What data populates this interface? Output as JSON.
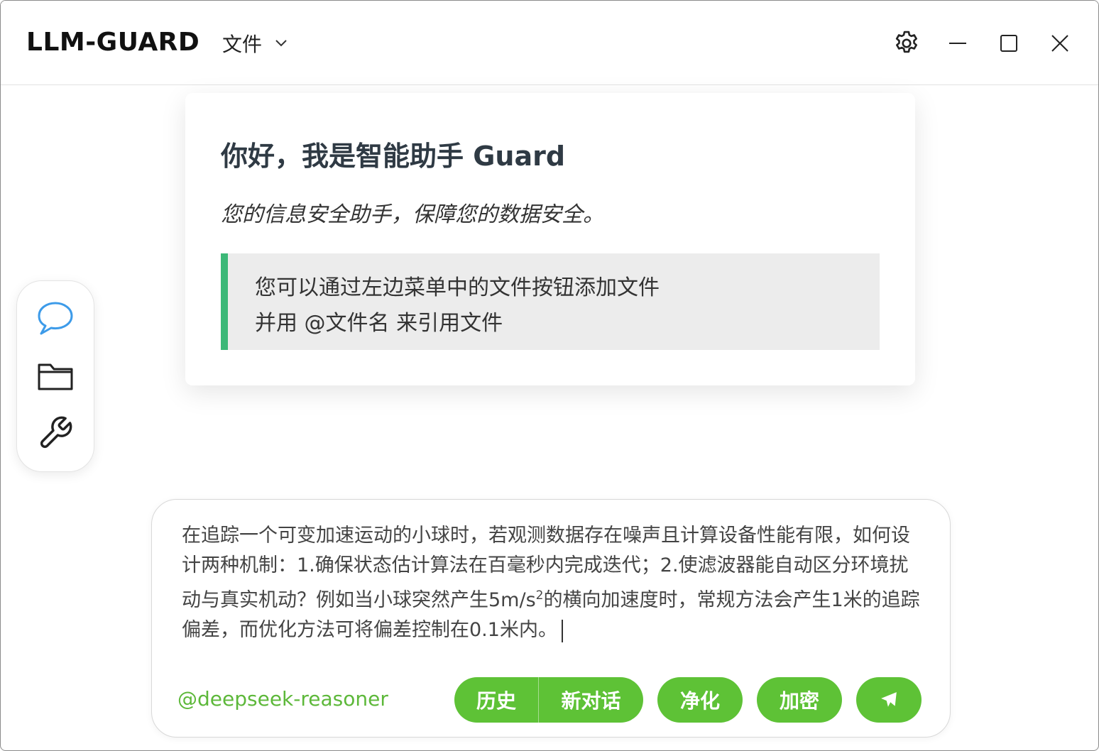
{
  "app": {
    "title": "LLM-GUARD",
    "file_menu_label": "文件"
  },
  "sidebar": {
    "items": [
      {
        "name": "chat",
        "icon": "chat-bubble-icon",
        "active": true
      },
      {
        "name": "files",
        "icon": "folder-icon",
        "active": false
      },
      {
        "name": "tools",
        "icon": "wrench-icon",
        "active": false
      }
    ]
  },
  "welcome": {
    "title": "你好，我是智能助手 Guard",
    "subtitle": "您的信息安全助手，保障您的数据安全。",
    "tip_line1": "您可以通过左边菜单中的文件按钮添加文件",
    "tip_line2": "并用 @文件名 来引用文件"
  },
  "composer": {
    "text_before_sup": "在追踪一个可变加速运动的小球时，若观测数据存在噪声且计算设备性能有限，如何设计两种机制：1.确保状态估计算法在百毫秒内完成迭代；2.使滤波器能自动区分环境扰动与真实机动？例如当小球突然产生5m/s",
    "sup": "2",
    "text_after_sup": "的横向加速度时，常规方法会产生1米的追踪偏差，而优化方法可将偏差控制在0.1米内。",
    "model": "@deepseek-reasoner",
    "history_label": "历史",
    "new_chat_label": "新对话",
    "sanitize_label": "净化",
    "encrypt_label": "加密"
  },
  "colors": {
    "accent_green": "#5ec236",
    "quote_border": "#3cb878",
    "active_icon_blue": "#3d9be9"
  }
}
